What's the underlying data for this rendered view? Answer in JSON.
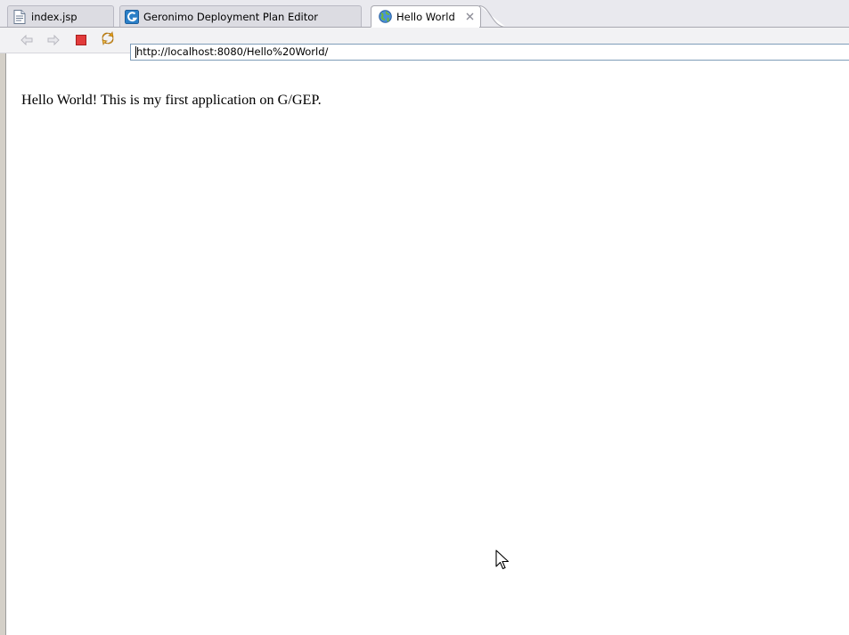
{
  "tabs": [
    {
      "label": "index.jsp",
      "icon": "jsp-file-icon",
      "active": false
    },
    {
      "label": "Geronimo Deployment Plan Editor",
      "icon": "geronimo-icon",
      "active": false
    },
    {
      "label": "Hello World",
      "icon": "globe-icon",
      "active": true
    }
  ],
  "browser": {
    "url": "http://localhost:8080/Hello%20World/"
  },
  "page": {
    "text": "Hello World! This is my first application on G/GEP."
  },
  "colors": {
    "stop": "#e23b3b",
    "refresh": "#e8a317",
    "geronimo_icon": "#2a7fc7"
  }
}
